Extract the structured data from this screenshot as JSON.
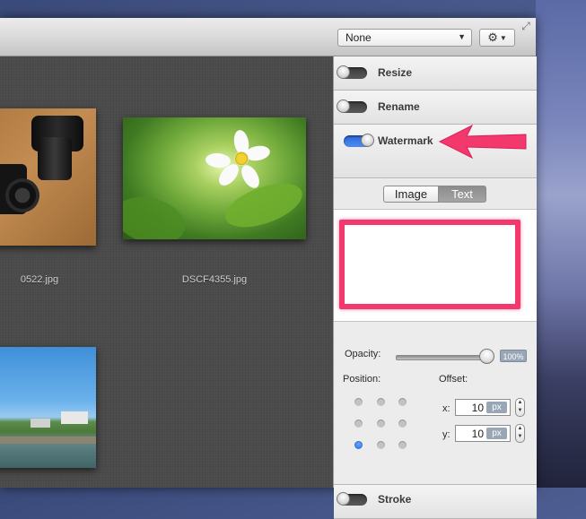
{
  "toolbar": {
    "preset_value": "None",
    "gear_icon": "gear-icon"
  },
  "gallery": {
    "items": [
      {
        "caption": "0522.jpg"
      },
      {
        "caption": "DSCF4355.jpg"
      },
      {
        "caption": ""
      }
    ]
  },
  "panel": {
    "sections": {
      "resize": {
        "label": "Resize",
        "enabled": false
      },
      "rename": {
        "label": "Rename",
        "enabled": false
      },
      "watermark": {
        "label": "Watermark",
        "enabled": true
      },
      "stroke": {
        "label": "Stroke",
        "enabled": false
      }
    },
    "watermark_tabs": {
      "image": "Image",
      "text": "Text",
      "selected": "Text"
    },
    "text_value": "",
    "opacity": {
      "label": "Opacity:",
      "value_label": "100%",
      "value": 1.0
    },
    "position": {
      "label": "Position:",
      "selected": "bottom-left"
    },
    "offset": {
      "label": "Offset:",
      "x_label": "x:",
      "x_value": "10",
      "x_unit": "px",
      "y_label": "y:",
      "y_value": "10",
      "y_unit": "px"
    }
  },
  "colors": {
    "annotation": "#f2386c",
    "toggle_on": "#2f6fe0"
  }
}
